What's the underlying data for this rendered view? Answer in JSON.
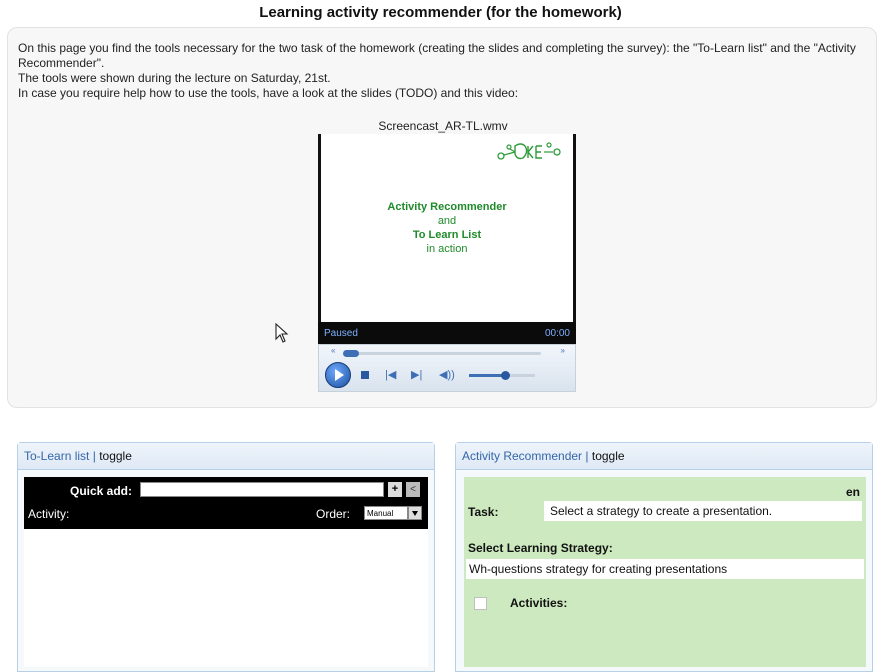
{
  "page": {
    "title": "Learning activity recommender (for the homework)"
  },
  "intro": {
    "line1": "On this page you find the tools necessary for the two task of the homework (creating the slides and completing the survey): the \"To-Learn list\" and the \"Activity Recommender\".",
    "line2": "The tools were shown during the lecture on Saturday, 21st.",
    "line3": "In case you require help how to use the tools, have a look at the slides (TODO) and this video:"
  },
  "video": {
    "caption": "Screencast_AR-TL.wmv",
    "frame_line1": "Activity Recommender",
    "frame_line2": "and",
    "frame_line3": "To Learn List",
    "frame_line4": "in action",
    "status": "Paused",
    "time": "00:00",
    "seek_back_icon": "«",
    "seek_fwd_icon": "»",
    "prev_icon": "|◀",
    "next_icon": "▶|",
    "volume_icon": "◀))",
    "volume_level": 0.55
  },
  "todo_panel": {
    "header_link": "To-Learn list",
    "separator": "|",
    "toggle": "toggle",
    "quick_add_label": "Quick add:",
    "quick_add_value": "",
    "add_button": "+",
    "back_button": "<",
    "activity_label": "Activity:",
    "order_label": "Order:",
    "order_value": "Manual"
  },
  "recommender_panel": {
    "header_link": "Activity Recommender",
    "separator": "|",
    "toggle": "toggle",
    "language": "en",
    "task_label": "Task:",
    "task_value": "Select a strategy to create a presentation.",
    "strategy_label": "Select Learning Strategy:",
    "strategy_value": "Wh-questions strategy for creating presentations",
    "activities_label": "Activities:"
  },
  "colors": {
    "panel_header_link": "#3466a8",
    "recommender_bg": "#cde9c0",
    "video_text": "#1f8a2a",
    "status_text": "#7fb0ff"
  }
}
